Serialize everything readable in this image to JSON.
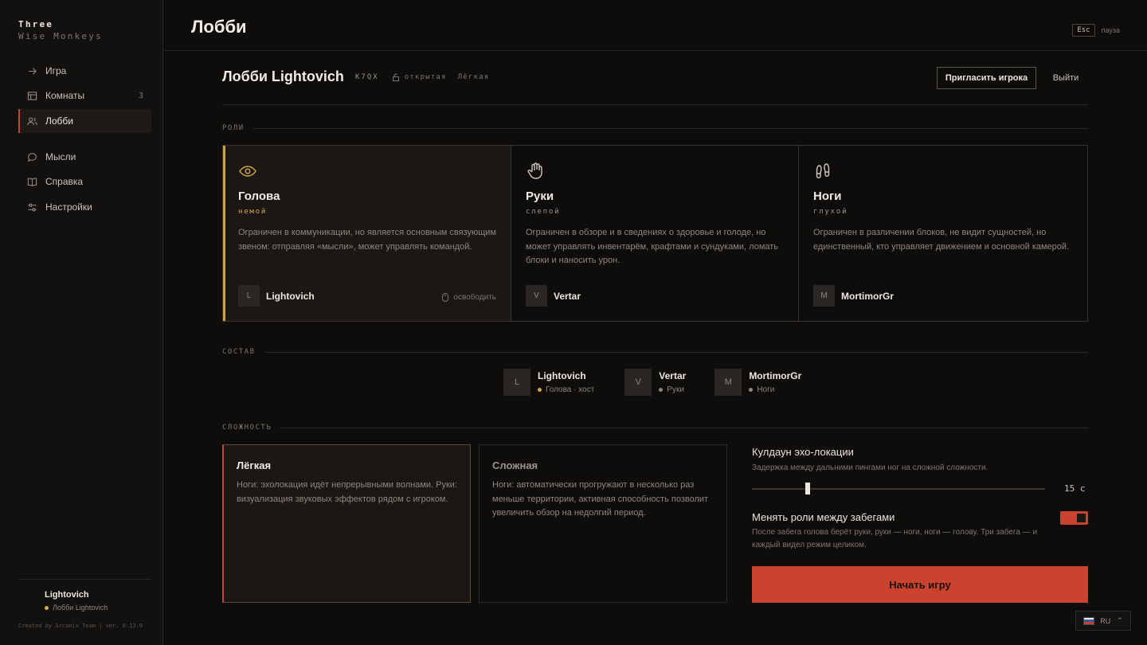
{
  "brand": {
    "line1": "Three",
    "line2": "Wise Monkeys"
  },
  "sidebar": {
    "items": [
      {
        "label": "Игра",
        "icon": "arrow-right-icon"
      },
      {
        "label": "Комнаты",
        "icon": "rooms-icon",
        "badge": "3"
      },
      {
        "label": "Лобби",
        "icon": "users-icon",
        "active": true
      },
      {
        "label": "Мысли",
        "icon": "chat-icon"
      },
      {
        "label": "Справка",
        "icon": "book-icon"
      },
      {
        "label": "Настройки",
        "icon": "sliders-icon"
      }
    ],
    "user": {
      "name": "Lightovich",
      "lobby": "Лобби Lightovich"
    },
    "credit": "Created by Arcanix Team | ver. 0.13.0"
  },
  "header": {
    "title": "Лобби",
    "esc_key": "Esc",
    "esc_label": "пауза"
  },
  "lobby": {
    "title": "Лобби Lightovich",
    "code": "K7QX",
    "access": "открытая",
    "difficulty": "Лёгкая",
    "invite_label": "Пригласить игрока",
    "exit_label": "Выйти"
  },
  "sections": {
    "roles": "РОЛИ",
    "roster": "СОСТАВ",
    "difficulty": "СЛОЖНОСТЬ"
  },
  "roles": [
    {
      "name": "Голова",
      "tag": "немой",
      "icon": "eye-icon",
      "desc": "Ограничен в коммуникации, но является основным связующим звеном: отправляя «мысли», может управлять командой.",
      "player_initial": "L",
      "player": "Lightovich",
      "release": "освободить"
    },
    {
      "name": "Руки",
      "tag": "слепой",
      "icon": "hand-icon",
      "desc": "Ограничен в обзоре и в сведениях о здоровье и голоде, но может управлять инвентарём, крафтами и сундуками, ломать блоки и наносить урон.",
      "player_initial": "V",
      "player": "Vertar"
    },
    {
      "name": "Ноги",
      "tag": "глухой",
      "icon": "footprints-icon",
      "desc": "Ограничен в различении блоков, не видит сущностей, но единственный, кто управляет движением и основной камерой.",
      "player_initial": "M",
      "player": "MortimorGr"
    }
  ],
  "roster": [
    {
      "initial": "L",
      "name": "Lightovich",
      "role": "Голова · хост"
    },
    {
      "initial": "V",
      "name": "Vertar",
      "role": "Руки"
    },
    {
      "initial": "M",
      "name": "MortimorGr",
      "role": "Ноги"
    }
  ],
  "difficulties": [
    {
      "name": "Лёгкая",
      "desc": "Ноги: эхолокация идёт непрерывными волнами. Руки: визуализация звуковых эффектов рядом с игроком."
    },
    {
      "name": "Сложная",
      "desc": "Ноги: автоматически прогружают в несколько раз меньше территории, активная способность позволит увеличить обзор на недолгий период."
    }
  ],
  "settings": {
    "echo_title": "Кулдаун эхо-локации",
    "echo_desc": "Задержка между дальними пингами ног на сложной сложности.",
    "echo_value": "15 с",
    "echo_fraction": 0.19,
    "swap_title": "Менять роли между забегами",
    "swap_desc": "После забега голова берёт руки, руки — ноги, ноги — голову. Три забега — и каждый видел режим целиком.",
    "swap_enabled": true
  },
  "start_label": "Начать игру",
  "language": "RU",
  "colors": {
    "accent": "#c9432f",
    "gold": "#d9a54a",
    "background": "#0f0d0c"
  }
}
